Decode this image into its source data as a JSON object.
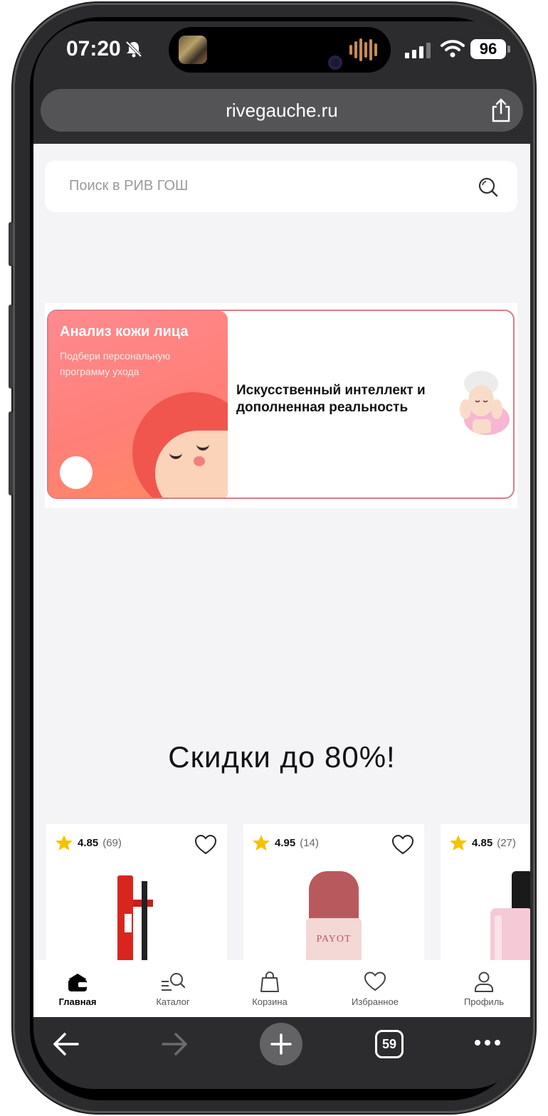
{
  "status_bar": {
    "time": "07:20",
    "battery": "96"
  },
  "browser": {
    "url": "rivegauche.ru",
    "open_tabs": "59"
  },
  "search": {
    "placeholder": "Поиск в РИВ ГОШ"
  },
  "banner": {
    "title": "Анализ кожи лица",
    "subtitle": "Подбери персональную программу ухода",
    "text": "Искусственный интеллект и дополненная реальность",
    "accent_color": "#ff7f78",
    "border_color": "#e07a84"
  },
  "promo": {
    "title": "Скидки до 80%!"
  },
  "products": [
    {
      "rating": "4.85",
      "reviews": "(69)",
      "image_icon": "mascara-icon"
    },
    {
      "rating": "4.95",
      "reviews": "(14)",
      "image_icon": "deodorant-icon",
      "brand": "PAYOT"
    },
    {
      "rating": "4.85",
      "reviews": "(27)",
      "image_icon": "perfume-icon"
    }
  ],
  "tabbar": {
    "items": [
      {
        "label": "Главная",
        "icon": "home-icon",
        "active": true
      },
      {
        "label": "Каталог",
        "icon": "catalog-search-icon"
      },
      {
        "label": "Корзина",
        "icon": "bag-icon"
      },
      {
        "label": "Избранное",
        "icon": "heart-icon"
      },
      {
        "label": "Профиль",
        "icon": "profile-icon"
      }
    ]
  },
  "colors": {
    "star": "#f5c400",
    "dark_chrome": "#2c2c2e",
    "page_bg": "#f4f4f6"
  }
}
